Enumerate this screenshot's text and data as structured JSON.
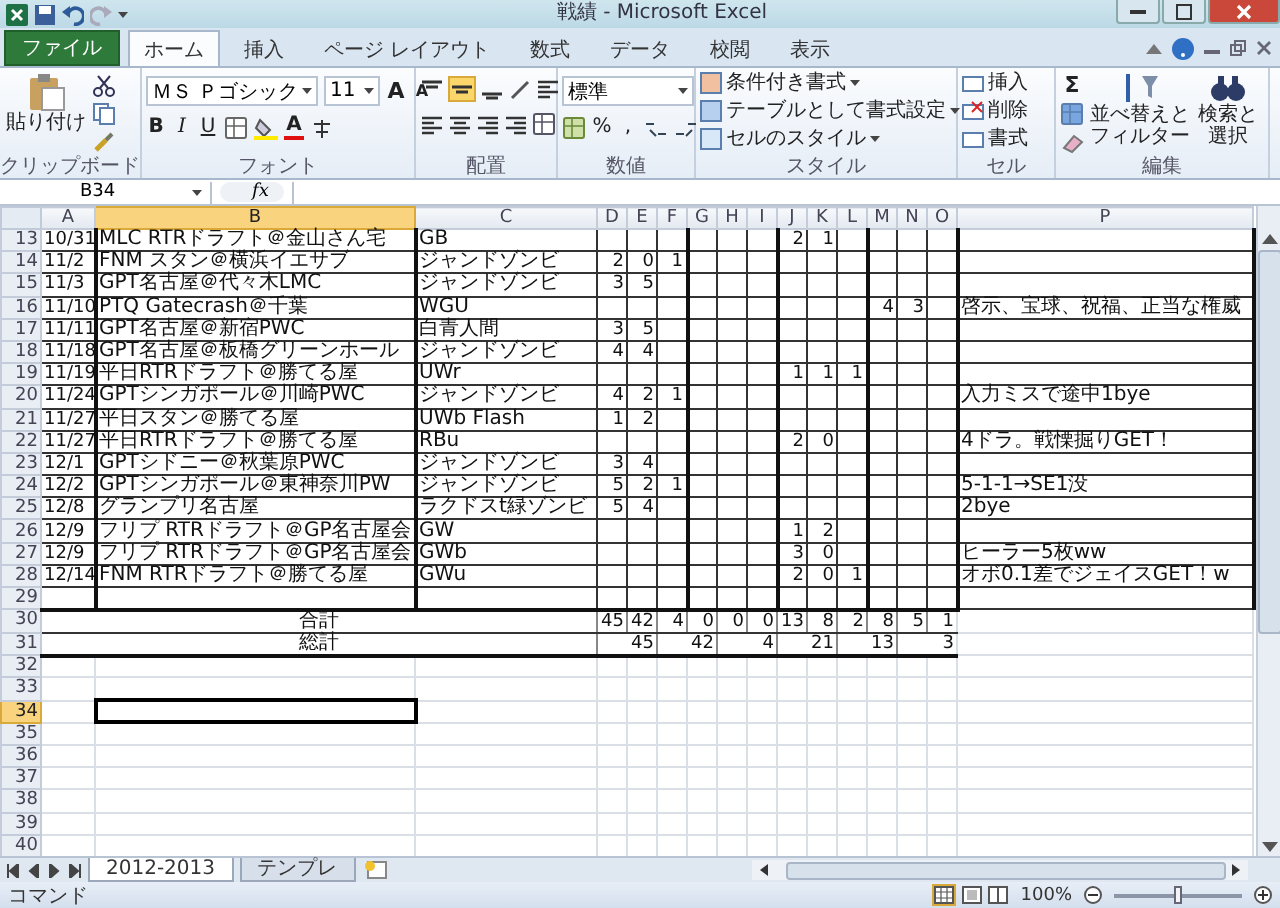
{
  "window": {
    "title": "戦績 - Microsoft Excel"
  },
  "tabs": [
    {
      "label": "ファイル",
      "kind": "file",
      "selected": false
    },
    {
      "label": "ホーム",
      "kind": "tab",
      "selected": true
    },
    {
      "label": "挿入",
      "kind": "tab",
      "selected": false
    },
    {
      "label": "ページ レイアウト",
      "kind": "tab",
      "selected": false
    },
    {
      "label": "数式",
      "kind": "tab",
      "selected": false
    },
    {
      "label": "データ",
      "kind": "tab",
      "selected": false
    },
    {
      "label": "校閲",
      "kind": "tab",
      "selected": false
    },
    {
      "label": "表示",
      "kind": "tab",
      "selected": false
    }
  ],
  "clipboard": {
    "paste": "貼り付け",
    "label": "クリップボード"
  },
  "font": {
    "name": "ＭＳ Ｐゴシック",
    "size": "11",
    "grow": "A",
    "shrink": "A",
    "bold": "B",
    "italic": "I",
    "underline": "U",
    "font_color": "A",
    "label": "フォント"
  },
  "alignment": {
    "label": "配置"
  },
  "number": {
    "format": "標準",
    "percent": "%",
    "comma": ",",
    "label": "数値"
  },
  "styles": {
    "items": [
      "条件付き書式",
      "テーブルとして書式設定",
      "セルのスタイル"
    ],
    "label": "スタイル"
  },
  "cells": {
    "items": [
      "挿入",
      "削除",
      "書式"
    ],
    "label": "セル"
  },
  "editing": {
    "sum": "Σ",
    "sort": [
      "並べ替えと",
      "フィルター"
    ],
    "find": [
      "検索と",
      "選択"
    ],
    "label": "編集"
  },
  "formula_bar": {
    "name_box": "B34",
    "fx": "fx"
  },
  "sheet": {
    "columns": [
      {
        "label": "A",
        "selected": false
      },
      {
        "label": "B",
        "selected": true
      },
      {
        "label": "C",
        "selected": false
      },
      {
        "label": "D",
        "selected": false
      },
      {
        "label": "E",
        "selected": false
      },
      {
        "label": "F",
        "selected": false
      },
      {
        "label": "G",
        "selected": false
      },
      {
        "label": "H",
        "selected": false
      },
      {
        "label": "I",
        "selected": false
      },
      {
        "label": "J",
        "selected": false
      },
      {
        "label": "K",
        "selected": false
      },
      {
        "label": "L",
        "selected": false
      },
      {
        "label": "M",
        "selected": false
      },
      {
        "label": "N",
        "selected": false
      },
      {
        "label": "O",
        "selected": false
      },
      {
        "label": "P",
        "selected": false
      }
    ],
    "rows": [
      {
        "number": "13",
        "selected": false,
        "kind": "entry",
        "cells": [
          "10/31",
          "MLC RTRドラフト＠金山さん宅",
          "GB",
          null,
          null,
          null,
          null,
          null,
          null,
          "2",
          "1"
        ]
      },
      {
        "number": "14",
        "selected": false,
        "kind": "entry",
        "cells": [
          "11/2",
          "FNM スタン＠横浜イエサブ",
          "ジャンドゾンビ",
          "2",
          "0",
          "1"
        ]
      },
      {
        "number": "15",
        "selected": false,
        "kind": "entry",
        "cells": [
          "11/3",
          "GPT名古屋＠代々木LMC",
          "ジャンドゾンビ",
          "3",
          "5"
        ]
      },
      {
        "number": "16",
        "selected": false,
        "kind": "entry",
        "cells": [
          "11/10",
          "PTQ Gatecrash＠千葉",
          "WGU",
          null,
          null,
          null,
          null,
          null,
          null,
          null,
          null,
          null,
          "4",
          "3",
          null,
          "啓示、宝球、祝福、正当な権威"
        ]
      },
      {
        "number": "17",
        "selected": false,
        "kind": "entry",
        "cells": [
          "11/11",
          "GPT名古屋＠新宿PWC",
          "白青人間",
          "3",
          "5"
        ]
      },
      {
        "number": "18",
        "selected": false,
        "kind": "entry",
        "cells": [
          "11/18",
          "GPT名古屋＠板橋グリーンホール",
          "ジャンドゾンビ",
          "4",
          "4"
        ]
      },
      {
        "number": "19",
        "selected": false,
        "kind": "entry",
        "cells": [
          "11/19",
          "平日RTRドラフト＠勝てる屋",
          "UWr",
          null,
          null,
          null,
          null,
          null,
          null,
          "1",
          "1",
          "1"
        ]
      },
      {
        "number": "20",
        "selected": false,
        "kind": "entry",
        "cells": [
          "11/24",
          "GPTシンガポール＠川崎PWC",
          "ジャンドゾンビ",
          "4",
          "2",
          "1",
          null,
          null,
          null,
          null,
          null,
          null,
          null,
          null,
          null,
          "入力ミスで途中1bye"
        ]
      },
      {
        "number": "21",
        "selected": false,
        "kind": "entry",
        "cells": [
          "11/27",
          "平日スタン＠勝てる屋",
          "UWb Flash",
          "1",
          "2"
        ]
      },
      {
        "number": "22",
        "selected": false,
        "kind": "entry",
        "cells": [
          "11/27",
          "平日RTRドラフト＠勝てる屋",
          "RBu",
          null,
          null,
          null,
          null,
          null,
          null,
          "2",
          "0",
          null,
          null,
          null,
          null,
          "4ドラ。戦慄掘りGET！"
        ]
      },
      {
        "number": "23",
        "selected": false,
        "kind": "entry",
        "cells": [
          "12/1",
          "GPTシドニー＠秋葉原PWC",
          "ジャンドゾンビ",
          "3",
          "4"
        ]
      },
      {
        "number": "24",
        "selected": false,
        "kind": "entry",
        "cells": [
          "12/2",
          "GPTシンガポール＠東神奈川PW",
          "ジャンドゾンビ",
          "5",
          "2",
          "1",
          null,
          null,
          null,
          null,
          null,
          null,
          null,
          null,
          null,
          "5-1-1→SE1没"
        ]
      },
      {
        "number": "25",
        "selected": false,
        "kind": "entry",
        "cells": [
          "12/8",
          "グランプリ名古屋",
          "ラクドスt緑ゾンビ",
          "5",
          "4",
          null,
          null,
          null,
          null,
          null,
          null,
          null,
          null,
          null,
          null,
          "2bye"
        ]
      },
      {
        "number": "26",
        "selected": false,
        "kind": "entry",
        "cells": [
          "12/9",
          "フリプ RTRドラフト＠GP名古屋会",
          "GW",
          null,
          null,
          null,
          null,
          null,
          null,
          "1",
          "2"
        ]
      },
      {
        "number": "27",
        "selected": false,
        "kind": "entry",
        "cells": [
          "12/9",
          "フリプ RTRドラフト＠GP名古屋会",
          "GWb",
          null,
          null,
          null,
          null,
          null,
          null,
          "3",
          "0",
          null,
          null,
          null,
          null,
          "ヒーラー5枚ww"
        ]
      },
      {
        "number": "28",
        "selected": false,
        "kind": "entry",
        "cells": [
          "12/14",
          "FNM RTRドラフト＠勝てる屋",
          "GWu",
          null,
          null,
          null,
          null,
          null,
          null,
          "2",
          "0",
          "1",
          null,
          null,
          null,
          "オボ0.1差でジェイスGET！w"
        ]
      },
      {
        "number": "29",
        "selected": false,
        "kind": "entry"
      },
      {
        "number": "30",
        "selected": false,
        "kind": "total",
        "label": "合計",
        "values": [
          "45",
          "42",
          "4",
          "0",
          "0",
          "0",
          "13",
          "8",
          "2",
          "8",
          "5",
          "1"
        ]
      },
      {
        "number": "31",
        "selected": false,
        "kind": "grand_total",
        "label": "総計",
        "values": [
          "45",
          "42",
          "4",
          "21",
          "13",
          "3"
        ]
      },
      {
        "number": "32",
        "selected": false,
        "kind": "blank"
      },
      {
        "number": "33",
        "selected": false,
        "kind": "blank"
      },
      {
        "number": "34",
        "selected": true,
        "kind": "blank"
      },
      {
        "number": "35",
        "selected": false,
        "kind": "blank"
      },
      {
        "number": "36",
        "selected": false,
        "kind": "blank"
      },
      {
        "number": "37",
        "selected": false,
        "kind": "blank"
      },
      {
        "number": "38",
        "selected": false,
        "kind": "blank"
      },
      {
        "number": "39",
        "selected": false,
        "kind": "blank"
      },
      {
        "number": "40",
        "selected": false,
        "kind": "blank"
      }
    ]
  },
  "sheet_tabs": [
    {
      "label": "2012-2013",
      "selected": true
    },
    {
      "label": "テンプレ",
      "selected": false
    }
  ],
  "status_bar": {
    "mode": "コマンド",
    "zoom": "100%",
    "zoom_slider": {
      "level": 0.5
    }
  }
}
